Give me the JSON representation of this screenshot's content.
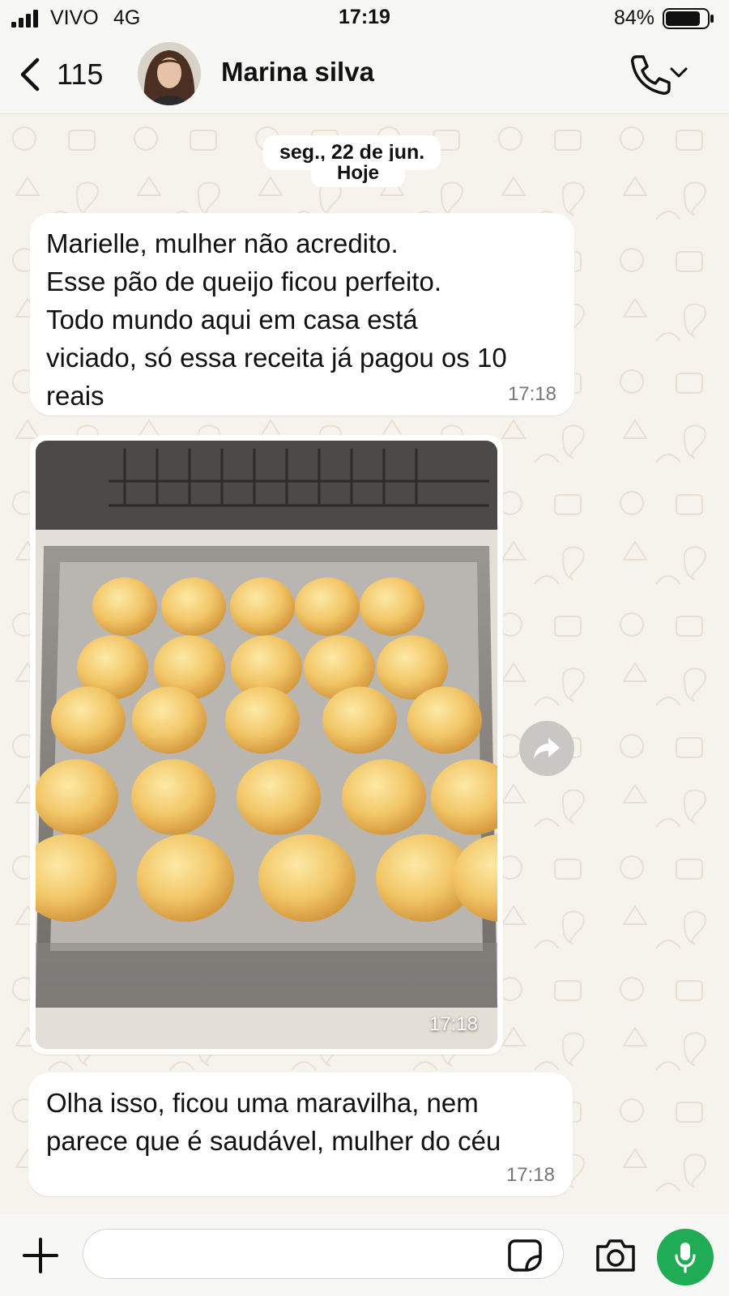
{
  "status_bar": {
    "carrier": "VIVO",
    "network": "4G",
    "time": "17:19",
    "battery_percent": "84%",
    "battery_level": 0.84
  },
  "header": {
    "back_count": "115",
    "contact_name": "Marina silva"
  },
  "chat": {
    "date_label": "seg., 22 de jun.",
    "today_label": "Hoje",
    "messages": [
      {
        "text": "Marielle, mulher não acredito.\nEsse pão de queijo ficou perfeito.\nTodo mundo aqui em casa está\nviciado, só essa receita já pagou os 10\nreais",
        "time": "17:18"
      },
      {
        "type": "image",
        "content": "pão de queijo",
        "time": "17:18"
      },
      {
        "text": "Olha isso, ficou uma maravilha, nem\nparece que é saudável, mulher do céu",
        "time": "17:18"
      }
    ]
  },
  "input": {
    "placeholder": ""
  },
  "colors": {
    "accent": "#1fac54",
    "bubble": "#ffffff",
    "wallpaper": "#f6f2ec"
  },
  "icons": [
    "signal-icon",
    "battery-icon",
    "back-chevron-icon",
    "phone-icon",
    "chevron-down-icon",
    "forward-icon",
    "plus-icon",
    "sticker-icon",
    "camera-icon",
    "mic-icon"
  ]
}
